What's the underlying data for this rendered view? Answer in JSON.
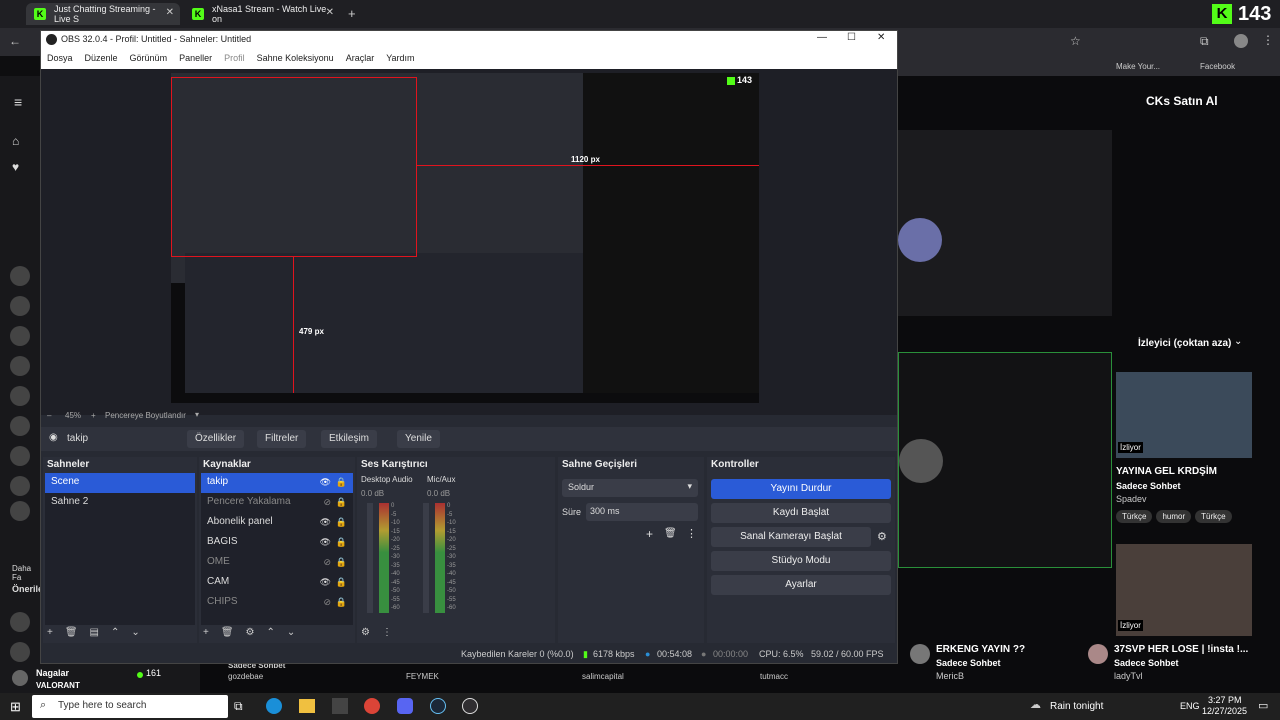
{
  "browser": {
    "tabs": [
      {
        "title": "Just Chatting Streaming - Live S"
      },
      {
        "title": "xNasa1 Stream - Watch Live on"
      }
    ],
    "bookmarks": [
      "Make Your...",
      "Facebook"
    ]
  },
  "kick": {
    "header_count": "143",
    "channel_name": "CKs Satın Al",
    "viewers_label": "İzleyici (çoktan aza)",
    "stream_title": "YAYINA GEL KRDŞİM",
    "stream_category": "Sadece Sohbet",
    "streamer": "Spadev",
    "tags": [
      "Türkçe",
      "humor",
      "Türkçe"
    ],
    "watching_label": "İzliyor",
    "bottom_cards": [
      {
        "title": "ERKENG YAYIN ??",
        "category": "Sadece Sohbet",
        "user": "MericB"
      },
      {
        "title": "37SVP HER LOSE | !insta !...",
        "category": "Sadece Sohbet",
        "user": "ladyTvl"
      }
    ],
    "sidebar_sections": [
      "Daha Fa",
      "Önerile"
    ],
    "bottom_left": {
      "name": "Nagalar",
      "game": "VALORANT",
      "viewers": "161"
    },
    "below_names": [
      "Sadece Sohbet",
      "gozdebae",
      "FEYMEK",
      "salimcapital",
      "tutmacc"
    ]
  },
  "obs": {
    "title": "OBS 32.0.4 - Profil: Untitled - Sahneler: Untitled",
    "menu": [
      "Dosya",
      "Düzenle",
      "Görünüm",
      "Paneller",
      "Profil",
      "Sahne Koleksiyonu",
      "Araçlar",
      "Yardım"
    ],
    "preview": {
      "dim_width": "1120 px",
      "dim_height": "479 px",
      "corner_count": "143"
    },
    "zoom": "45%",
    "zoom_mode": "Pencereye Boyutlandır",
    "selected_source": "takip",
    "toolbar": [
      "Özellikler",
      "Filtreler",
      "Etkileşim",
      "Yenile"
    ],
    "scenes": {
      "title": "Sahneler",
      "items": [
        "Scene",
        "Sahne 2"
      ]
    },
    "sources": {
      "title": "Kaynaklar",
      "items": [
        {
          "name": "takip",
          "state": "selected"
        },
        {
          "name": "Pencere Yakalama",
          "state": "hidden"
        },
        {
          "name": "Abonelik panel",
          "state": "visible"
        },
        {
          "name": "BAGIS",
          "state": "visible"
        },
        {
          "name": "OME",
          "state": "hidden"
        },
        {
          "name": "CAM",
          "state": "visible"
        },
        {
          "name": "CHIPS",
          "state": "hidden"
        }
      ]
    },
    "mixer": {
      "title": "Ses Karıştırıcı",
      "channels": [
        {
          "name": "Desktop Audio",
          "db": "0.0 dB"
        },
        {
          "name": "Mic/Aux",
          "db": "0.0 dB"
        }
      ],
      "scale": [
        "0",
        "-5",
        "-10",
        "-15",
        "-20",
        "-25",
        "-30",
        "-35",
        "-40",
        "-45",
        "-50",
        "-55",
        "-60"
      ]
    },
    "transitions": {
      "title": "Sahne Geçişleri",
      "type": "Soldur",
      "duration_label": "Süre",
      "duration": "300 ms"
    },
    "controls": {
      "title": "Kontroller",
      "buttons": [
        "Yayını Durdur",
        "Kaydı Başlat",
        "Sanal Kamerayı Başlat",
        "Stüdyo Modu",
        "Ayarlar"
      ]
    },
    "status": {
      "dropped": "Kaybedilen Kareler 0 (%0.0)",
      "bitrate": "6178 kbps",
      "stream_time": "00:54:08",
      "rec_time": "00:00:00",
      "cpu": "CPU: 6.5%",
      "fps": "59.02 / 60.00 FPS"
    }
  },
  "taskbar": {
    "search_placeholder": "Type here to search",
    "weather": "Rain tonight",
    "lang": "ENG",
    "time": "3:27 PM",
    "date": "12/27/2025"
  },
  "colors": {
    "kick_green": "#53fc18",
    "obs_accent": "#2a5bd7",
    "live_red": "#e0141e"
  }
}
